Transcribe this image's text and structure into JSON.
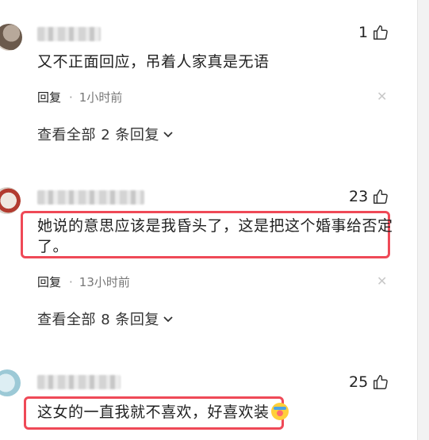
{
  "comments": [
    {
      "text": "又不正面回应，吊着人家真是无语",
      "likes": "1",
      "reply_label": "回复",
      "time": "1小时前",
      "view_all": "查看全部 2 条回复"
    },
    {
      "text_line1": "她说的意思应该是我昏头了，这是把这个婚事给否定",
      "text_line2": "了。",
      "likes": "23",
      "reply_label": "回复",
      "time": "13小时前",
      "view_all": "查看全部 8 条回复"
    },
    {
      "text": "这女的一直我就不喜欢，好喜欢装",
      "likes": "25"
    }
  ],
  "icons": {
    "like": "thumbs-up-icon",
    "close": "close-icon",
    "expand": "chevron-down-icon",
    "emoji": "emoji-icon"
  },
  "colors": {
    "highlight": "#ef4957"
  }
}
